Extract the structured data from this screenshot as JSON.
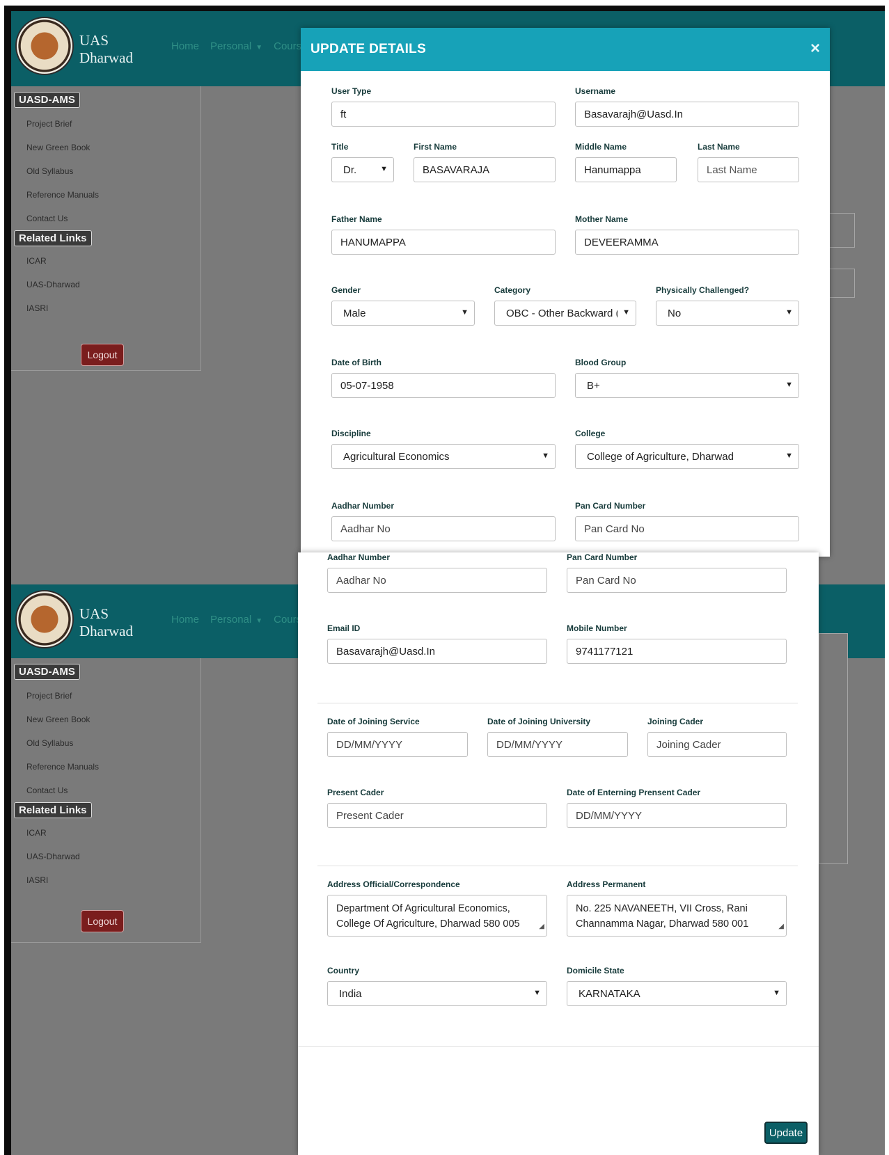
{
  "brand": {
    "line1": "UAS",
    "line2": "Dharwad"
  },
  "nav": {
    "home": "Home",
    "personal": "Personal",
    "course": "Course"
  },
  "sidebar": {
    "section1": "UASD-AMS",
    "items": [
      "Project Brief",
      "New Green Book",
      "Old Syllabus",
      "Reference Manuals",
      "Contact Us"
    ],
    "section2": "Related Links",
    "links": [
      "ICAR",
      "UAS-Dharwad",
      "IASRI"
    ],
    "logout": "Logout"
  },
  "modal": {
    "title": "UPDATE DETAILS",
    "close": "×",
    "update_label": "Update"
  },
  "form": {
    "user_type": {
      "label": "User Type",
      "value": "ft"
    },
    "username": {
      "label": "Username",
      "value": "Basavarajh@Uasd.In"
    },
    "title": {
      "label": "Title",
      "value": "Dr."
    },
    "first_name": {
      "label": "First Name",
      "value": "BASAVARAJA"
    },
    "middle_name": {
      "label": "Middle Name",
      "value": "Hanumappa"
    },
    "last_name": {
      "label": "Last Name",
      "placeholder": "Last Name"
    },
    "father_name": {
      "label": "Father Name",
      "value": "HANUMAPPA"
    },
    "mother_name": {
      "label": "Mother Name",
      "value": "DEVEERAMMA"
    },
    "gender": {
      "label": "Gender",
      "value": "Male"
    },
    "category": {
      "label": "Category",
      "value": "OBC - Other Backward ("
    },
    "physically_challenged": {
      "label": "Physically Challenged?",
      "value": "No"
    },
    "dob": {
      "label": "Date of Birth",
      "value": "05-07-1958"
    },
    "blood_group": {
      "label": "Blood Group",
      "value": "B+"
    },
    "discipline": {
      "label": "Discipline",
      "value": "Agricultural Economics"
    },
    "college": {
      "label": "College",
      "value": "College of Agriculture, Dharwad"
    },
    "aadhar": {
      "label": "Aadhar Number",
      "placeholder": "Aadhar No"
    },
    "pan": {
      "label": "Pan Card Number",
      "placeholder": "Pan Card No"
    },
    "email": {
      "label": "Email ID",
      "value": "Basavarajh@Uasd.In"
    },
    "mobile": {
      "label": "Mobile Number",
      "value": "9741177121"
    },
    "doj_service": {
      "label": "Date of Joining Service",
      "placeholder": "DD/MM/YYYY"
    },
    "doj_university": {
      "label": "Date of Joining University",
      "placeholder": "DD/MM/YYYY"
    },
    "joining_cader": {
      "label": "Joining Cader",
      "placeholder": "Joining Cader"
    },
    "present_cader": {
      "label": "Present Cader",
      "placeholder": "Present Cader"
    },
    "doe_present_cader": {
      "label": "Date of Enterning Prensent Cader",
      "placeholder": "DD/MM/YYYY"
    },
    "address_official": {
      "label": "Address Official/Correspondence",
      "line1": "Department Of Agricultural Economics,",
      "line2": "College Of Agriculture, Dharwad 580 005"
    },
    "address_permanent": {
      "label": "Address Permanent",
      "line1": "No. 225 NAVANEETH, VII Cross, Rani",
      "line2": "Channamma Nagar, Dharwad 580 001"
    },
    "country": {
      "label": "Country",
      "value": "India"
    },
    "domicile_state": {
      "label": "Domicile State",
      "value": "KARNATAKA"
    }
  },
  "colors": {
    "header": "#0b5f66",
    "modal_header": "#17a2b8",
    "logout": "#7a1d1d",
    "update": "#0b5f66"
  },
  "icons": {
    "close": "close-icon",
    "dropdown": "chevron-down-icon",
    "resize": "resize-handle-icon"
  }
}
